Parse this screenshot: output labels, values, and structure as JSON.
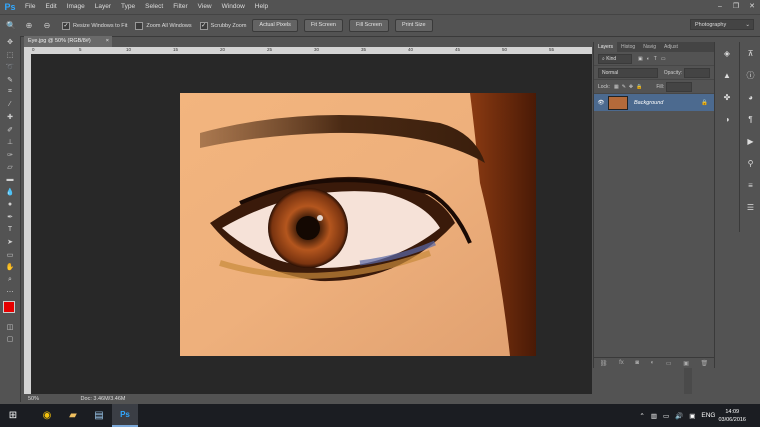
{
  "app": {
    "logo": "Ps"
  },
  "menu": [
    "File",
    "Edit",
    "Image",
    "Layer",
    "Type",
    "Select",
    "Filter",
    "View",
    "Window",
    "Help"
  ],
  "window_controls": [
    "–",
    "❐",
    "✕"
  ],
  "options": {
    "zoom_level_icon": "🔍",
    "checkboxes": [
      {
        "label": "Resize Windows to Fit",
        "checked": true
      },
      {
        "label": "Zoom All Windows",
        "checked": false
      },
      {
        "label": "Scrubby Zoom",
        "checked": true
      }
    ],
    "buttons": [
      "Actual Pixels",
      "Fit Screen",
      "Fill Screen",
      "Print Size"
    ],
    "workspace": "Photography"
  },
  "document": {
    "tab_title": "Eye.jpg @ 50% (RGB/8#)",
    "close": "×",
    "ruler_top": [
      "0",
      "5",
      "10",
      "15",
      "20",
      "25",
      "30",
      "35",
      "40",
      "45",
      "50",
      "55"
    ],
    "zoom": "50%",
    "doc_info": "Doc: 3.46M/3.46M"
  },
  "layers_panel": {
    "tabs": [
      "Layers",
      "Histog",
      "Navig",
      "Adjust"
    ],
    "kind_label": "Kind",
    "blend_mode": "Normal",
    "opacity_label": "Opacity:",
    "lock_label": "Lock:",
    "fill_label": "Fill:",
    "layer_name": "Background",
    "footer_icons": [
      "⛓",
      "fx",
      "◙",
      "◐",
      "▭",
      "▣",
      "🗑"
    ]
  },
  "taskbar": {
    "language": "ENG",
    "time": "14:09",
    "date": "03/06/2016"
  },
  "colors": {
    "foreground": "#e60000",
    "background": "#000000",
    "accent": "#31a8ff"
  }
}
